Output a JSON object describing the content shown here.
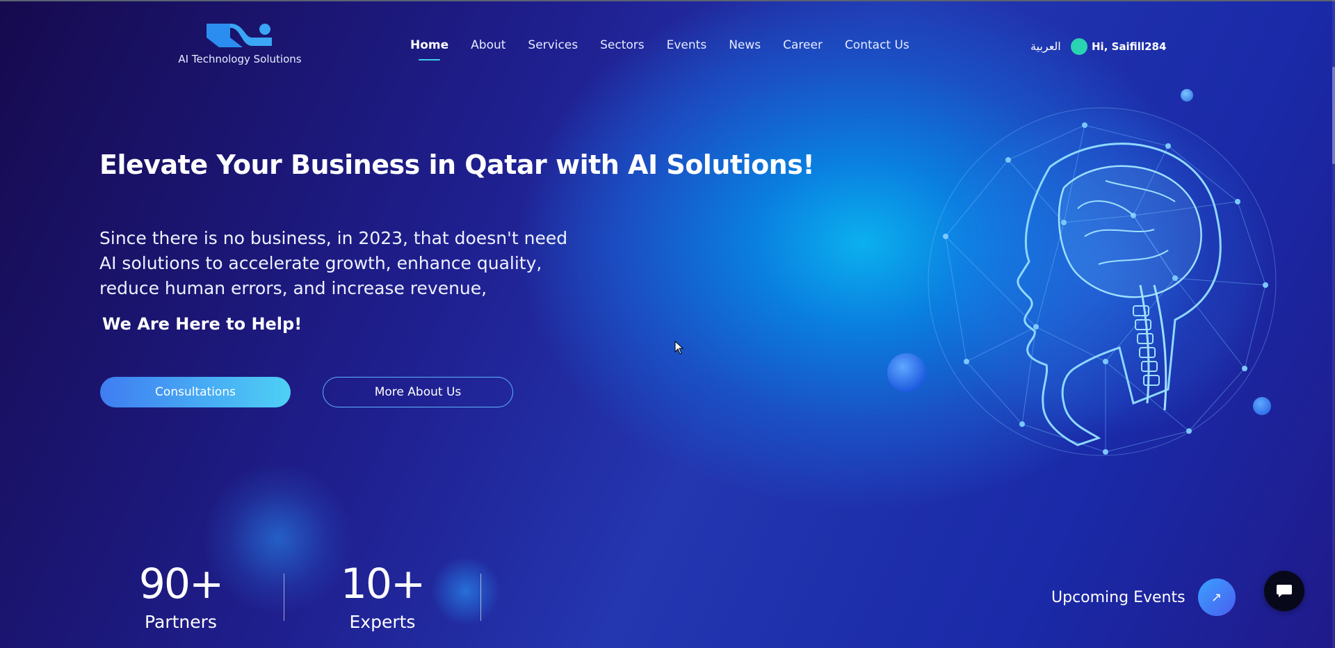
{
  "brand": {
    "logo_text": "AI Technology Solutions",
    "accent": "#3fd0e8"
  },
  "nav": {
    "items": [
      {
        "label": "Home",
        "active": true
      },
      {
        "label": "About"
      },
      {
        "label": "Services"
      },
      {
        "label": "Sectors"
      },
      {
        "label": "Events"
      },
      {
        "label": "News"
      },
      {
        "label": "Career"
      },
      {
        "label": "Contact Us"
      }
    ]
  },
  "header": {
    "language": "العربية",
    "user_greeting": "Hi, Saifill284",
    "avatar_color": "#2ad3b2"
  },
  "hero": {
    "headline": "Elevate Your Business in Qatar with AI Solutions!",
    "intro": "Since there is no business, in 2023, that doesn't need AI solutions to accelerate growth, enhance quality, reduce human errors, and increase revenue,",
    "tagline": "We Are Here to Help!",
    "primary_button": "Consultations",
    "secondary_button": "More About Us",
    "illustration": "ai-brain-head-icon"
  },
  "stats": [
    {
      "value": "90+",
      "label": "Partners"
    },
    {
      "value": "10+",
      "label": "Experts"
    }
  ],
  "events": {
    "label": "Upcoming Events",
    "icon": "arrow-up-right-icon"
  },
  "chat": {
    "icon": "chat-bubble-icon"
  }
}
